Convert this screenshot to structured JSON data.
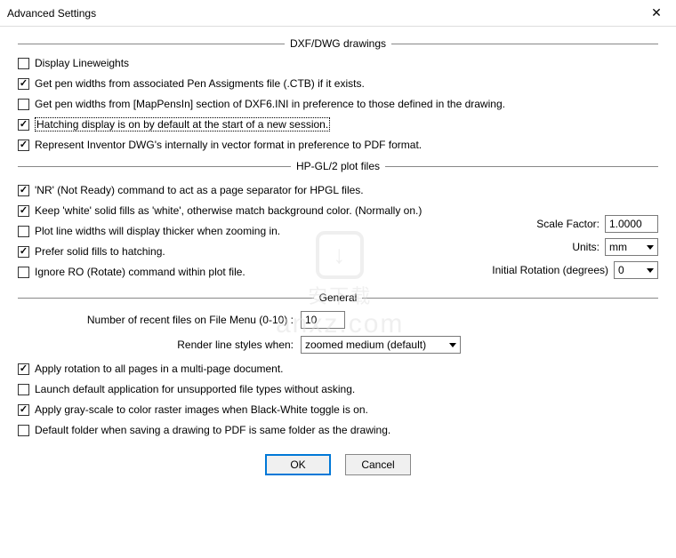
{
  "window": {
    "title": "Advanced Settings"
  },
  "sections": {
    "dxf": {
      "header": "DXF/DWG drawings"
    },
    "hpgl": {
      "header": "HP-GL/2 plot files"
    },
    "general": {
      "header": "General"
    }
  },
  "dxf": {
    "display_lineweights": {
      "label": "Display Lineweights",
      "checked": false
    },
    "get_pen_widths_ctb": {
      "label": "Get pen widths from associated Pen Assigments file (.CTB) if it exists.",
      "checked": true
    },
    "get_pen_widths_ini": {
      "label": "Get pen widths from [MapPensIn] section of DXF6.INI in preference to those defined in the drawing.",
      "checked": false
    },
    "hatching_default": {
      "label": "Hatching display is on by default at the start of a new session.",
      "checked": true
    },
    "represent_inventor": {
      "label": "Represent Inventor DWG's internally in vector format in preference to PDF format.",
      "checked": true
    }
  },
  "hpgl": {
    "nr_separator": {
      "label": "'NR' (Not Ready) command to act as a page separator for HPGL files.",
      "checked": true
    },
    "keep_white": {
      "label": "Keep 'white' solid fills as 'white', otherwise match background color. (Normally on.)",
      "checked": true
    },
    "plot_thicker": {
      "label": "Plot line widths will display thicker when zooming in.",
      "checked": false
    },
    "prefer_solid": {
      "label": "Prefer solid fills to hatching.",
      "checked": true
    },
    "ignore_ro": {
      "label": "Ignore RO (Rotate) command within plot file.",
      "checked": false
    },
    "scale_factor": {
      "label": "Scale Factor:",
      "value": "1.0000"
    },
    "units": {
      "label": "Units:",
      "value": "mm"
    },
    "initial_rotation": {
      "label": "Initial Rotation (degrees)",
      "value": "0"
    }
  },
  "general": {
    "recent_files": {
      "label": "Number of recent files on File Menu (0-10) :",
      "value": "10"
    },
    "render_line_styles": {
      "label": "Render line styles when:",
      "value": "zoomed medium (default)"
    },
    "apply_rotation": {
      "label": "Apply rotation to all pages in a multi-page document.",
      "checked": true
    },
    "launch_default": {
      "label": "Launch default application for unsupported file types without asking.",
      "checked": false
    },
    "apply_grayscale": {
      "label": "Apply gray-scale to color raster images when Black-White toggle is on.",
      "checked": true
    },
    "default_folder": {
      "label": "Default folder when saving a drawing to PDF is same folder as the drawing.",
      "checked": false
    }
  },
  "buttons": {
    "ok": "OK",
    "cancel": "Cancel"
  },
  "watermark": {
    "cn": "安下载",
    "en": "anxz.com"
  }
}
